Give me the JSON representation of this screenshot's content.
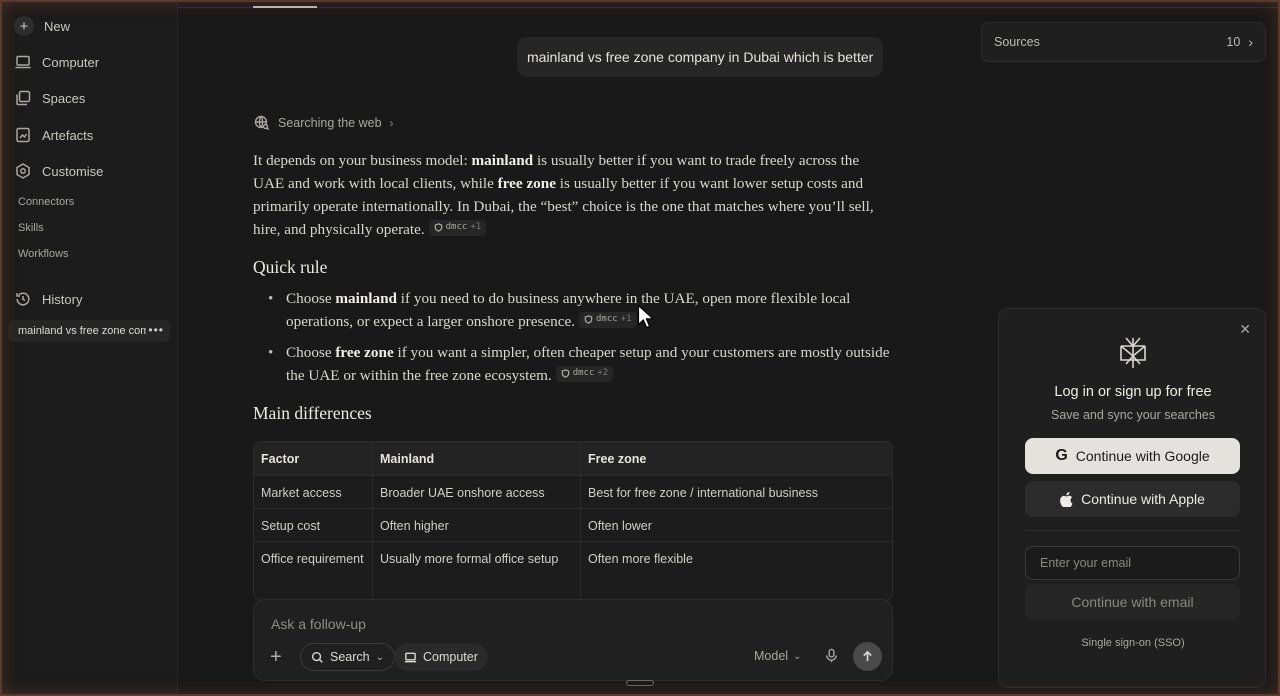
{
  "sidebar": {
    "new_label": "New",
    "items": [
      {
        "label": "Computer",
        "icon": "monitor-icon"
      },
      {
        "label": "Spaces",
        "icon": "spaces-icon"
      },
      {
        "label": "Artefacts",
        "icon": "artefacts-icon"
      },
      {
        "label": "Customise",
        "icon": "customise-icon"
      }
    ],
    "sub_items": [
      "Connectors",
      "Skills",
      "Workflows"
    ],
    "history_label": "History",
    "history_entries": [
      "mainland vs free zone company in Dubai which is better"
    ]
  },
  "thread": {
    "user_query": "mainland vs free zone company in Dubai which is better",
    "status": "Searching the web",
    "answer": {
      "p1_a": "It depends on your business model: ",
      "p1_b": "mainland",
      "p1_c": " is usually better if you want to trade freely across the UAE and work with local clients, while ",
      "p1_d": "free zone",
      "p1_e": " is usually better if you want lower setup costs and primarily operate internationally. In Dubai, the “best” choice is the one that matches where you’ll sell, hire, and physically operate.",
      "quick_rule_heading": "Quick rule",
      "bullet1_a": "Choose ",
      "bullet1_b": "mainland",
      "bullet1_c": " if you need to do business anywhere in the UAE, open more flexible local operations, or expect a larger onshore presence.",
      "bullet2_a": "Choose ",
      "bullet2_b": "free zone",
      "bullet2_c": " if you want a simpler, often cheaper setup and your customers are mostly outside the UAE or within the free zone ecosystem.",
      "main_diff_heading": "Main differences"
    },
    "citations": [
      {
        "source": "dmcc",
        "extra": "+1"
      },
      {
        "source": "dmcc",
        "extra": "+1"
      },
      {
        "source": "dmcc",
        "extra": "+2"
      }
    ],
    "table": {
      "headers": [
        "Factor",
        "Mainland",
        "Free zone"
      ],
      "rows": [
        [
          "Market access",
          "Broader UAE onshore access",
          "Best for free zone / international business"
        ],
        [
          "Setup cost",
          "Often higher",
          "Often lower"
        ],
        [
          "Office requirement",
          "Usually more formal office setup",
          "Often more flexible"
        ]
      ]
    }
  },
  "composer": {
    "placeholder": "Ask a follow-up",
    "search_label": "Search",
    "computer_label": "Computer",
    "model_label": "Model"
  },
  "sources": {
    "label": "Sources",
    "count": "10"
  },
  "login_panel": {
    "title": "Log in or sign up for free",
    "subtitle": "Save and sync your searches",
    "google_label": "Continue with Google",
    "apple_label": "Continue with Apple",
    "email_placeholder": "Enter your email",
    "email_button": "Continue with email",
    "sso_label": "Single sign-on (SSO)"
  }
}
